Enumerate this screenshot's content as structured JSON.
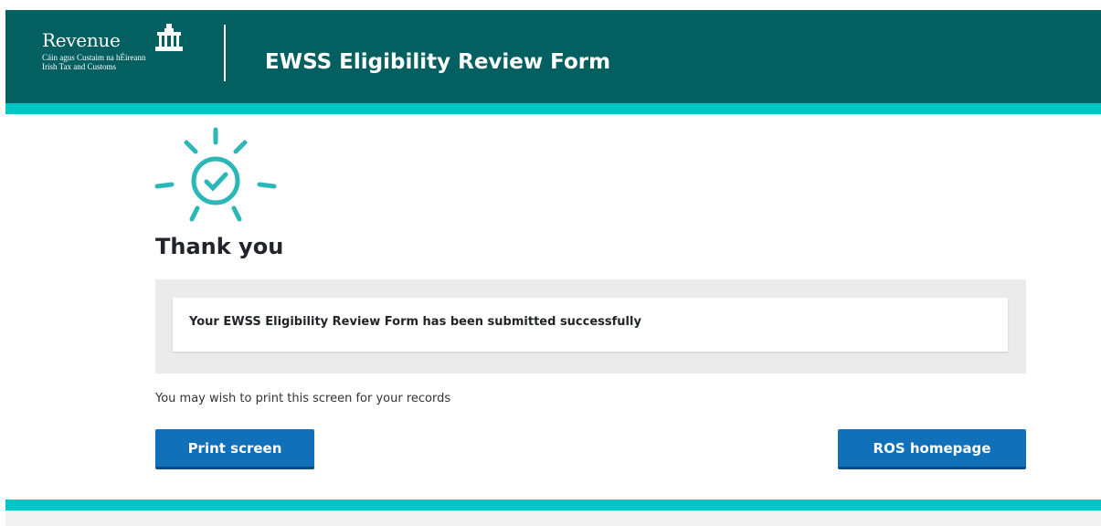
{
  "header": {
    "logo": {
      "name": "Revenue",
      "subtitle_irish": "Cáin agus Custaim na hÉireann",
      "subtitle_english": "Irish Tax and Customs",
      "icon": "customs-house-icon"
    },
    "title": "EWSS Eligibility Review Form"
  },
  "confirmation": {
    "icon": "sun-checkmark-icon",
    "heading": "Thank you",
    "message": "Your EWSS Eligibility Review Form has been submitted successfully",
    "hint": "You may wish to print this screen for your records"
  },
  "actions": {
    "print_label": "Print screen",
    "ros_label": "ROS homepage"
  },
  "colors": {
    "header_bg": "#045f61",
    "accent_teal": "#00c5c5",
    "button_blue": "#1170ba",
    "panel_grey": "#eaeaea"
  }
}
